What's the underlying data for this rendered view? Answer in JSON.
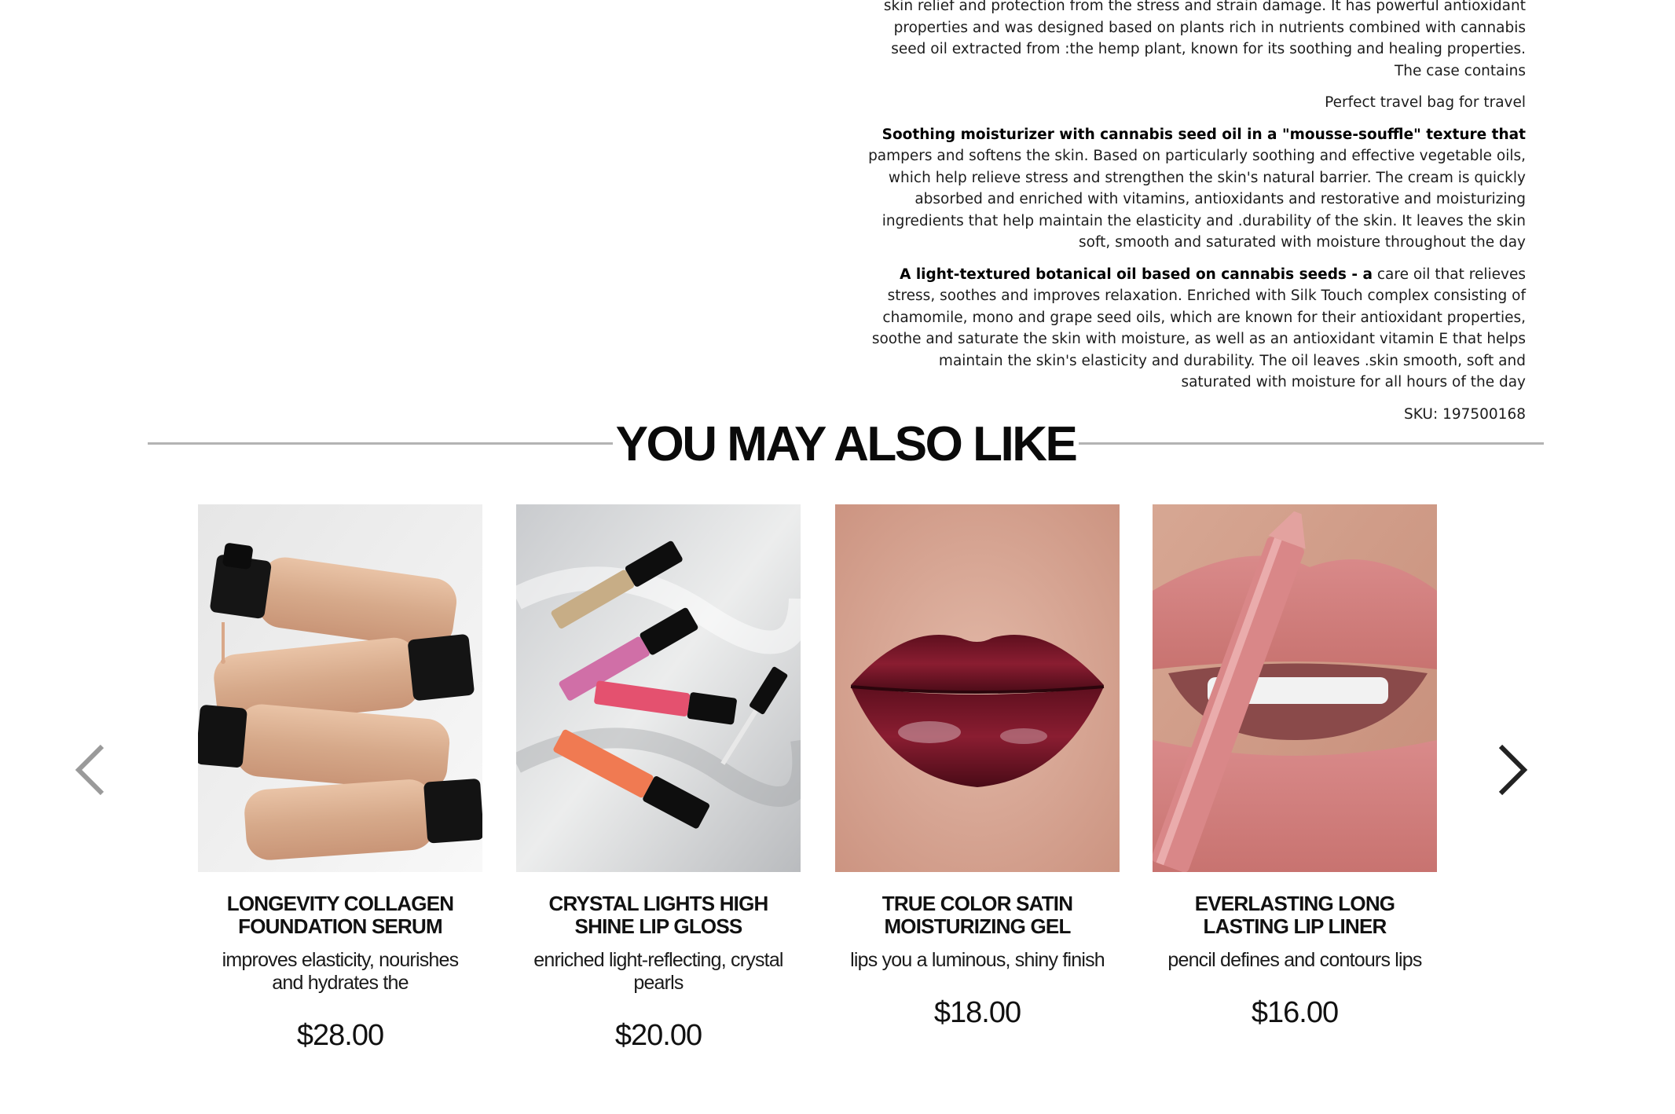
{
  "description": {
    "intro_lines": "skin relief and protection from the stress and strain damage. It has powerful antioxidant properties and was designed based on plants rich in nutrients combined with cannabis seed oil extracted from :the hemp plant, known for its soothing and healing properties. The case contains",
    "travel_bag": "Perfect travel bag for travel",
    "moisturizer_bold": "Soothing moisturizer with cannabis seed oil in a \"mousse-souffle\" texture that",
    "moisturizer_text": " pampers and softens the skin. Based on particularly soothing and effective vegetable oils, which help relieve stress and strengthen the skin's natural barrier. The cream is quickly absorbed and enriched with vitamins, antioxidants and restorative and moisturizing ingredients that help maintain the elasticity and .durability of the skin. It leaves the skin soft, smooth and saturated with moisture throughout the day",
    "oil_bold": "A light-textured botanical oil based on cannabis seeds - a",
    "oil_text": " care oil that relieves stress, soothes and improves relaxation. Enriched with Silk Touch complex consisting of chamomile, mono and grape seed oils, which are known for their antioxidant properties, soothe and saturate the skin with moisture, as well as an antioxidant vitamin E that helps maintain the skin's elasticity and durability. The oil leaves .skin smooth, soft and saturated with moisture for all hours of the day",
    "sku": "SKU: 197500168"
  },
  "recommendations": {
    "heading": "YOU MAY ALSO LIKE",
    "prev_icon": "chevron-left-icon",
    "next_icon": "chevron-right-icon",
    "products": [
      {
        "title": "LONGEVITY COLLAGEN FOUNDATION SERUM",
        "subtitle": "improves elasticity, nourishes and hydrates the",
        "price": "$28.00",
        "image": "foundation-bottles-image"
      },
      {
        "title": "CRYSTAL LIGHTS HIGH SHINE LIP GLOSS",
        "subtitle": "enriched light-reflecting, crystal pearls",
        "price": "$20.00",
        "image": "lip-gloss-tubes-image"
      },
      {
        "title": "TRUE COLOR SATIN MOISTURIZING GEL",
        "subtitle": "lips you a luminous, shiny finish",
        "price": "$18.00",
        "image": "burgundy-lips-image"
      },
      {
        "title": "EVERLASTING LONG LASTING LIP LINER",
        "subtitle": "pencil defines and contours lips",
        "price": "$16.00",
        "image": "pink-lip-liner-image"
      }
    ]
  },
  "colors": {
    "text": "#111111",
    "rule": "#b3b3b3",
    "arrow_prev": "#9a9a9a",
    "arrow_next": "#222222"
  }
}
